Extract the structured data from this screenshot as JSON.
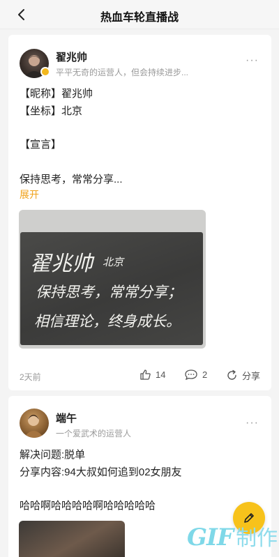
{
  "header": {
    "title": "热血车轮直播战"
  },
  "post1": {
    "author": "翟兆帅",
    "subtitle": "平平无奇的运营人，但会持续进步...",
    "more": "···",
    "lines": [
      "【昵称】翟兆帅",
      "【坐标】北京",
      "【宣言】",
      "保持思考，常常分享..."
    ],
    "expand": "展开",
    "chalkboard": [
      "翟兆帅",
      "北京",
      "保持思考，常常分享；",
      "相信理论，终身成长。"
    ],
    "time": "2天前",
    "likes": "14",
    "comments": "2",
    "share": "分享"
  },
  "post2": {
    "author": "端午",
    "subtitle": "一个爱武术的运营人",
    "more": "···",
    "lines": [
      "解决问题:脱单",
      "分享内容:94大叔如何追到02女朋友",
      "哈哈啊哈哈哈哈啊哈哈哈哈哈"
    ]
  },
  "watermark": {
    "gif": "GIF",
    "text": "制作"
  },
  "colors": {
    "accent": "#f0a21a",
    "fab": "#f7c21b",
    "watermark": "#7fd8e8"
  }
}
